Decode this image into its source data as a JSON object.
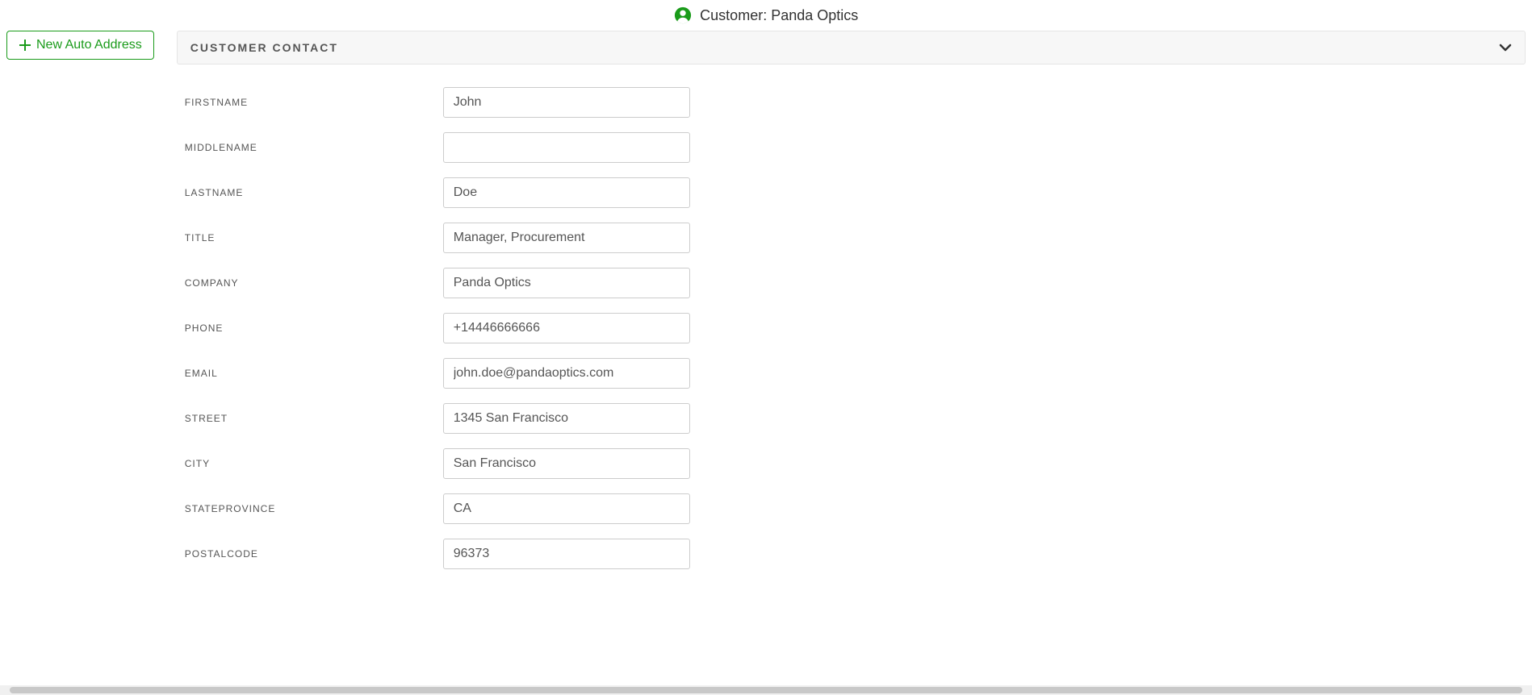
{
  "header": {
    "title": "Customer: Panda Optics"
  },
  "sidebar": {
    "new_address_label": "New Auto Address"
  },
  "panel": {
    "title": "CUSTOMER  CONTACT"
  },
  "form": {
    "firstname": {
      "label": "FIRSTNAME",
      "value": "John"
    },
    "middlename": {
      "label": "MIDDLENAME",
      "value": ""
    },
    "lastname": {
      "label": "LASTNAME",
      "value": "Doe"
    },
    "title": {
      "label": "TITLE",
      "value": "Manager, Procurement"
    },
    "company": {
      "label": "COMPANY",
      "value": "Panda Optics"
    },
    "phone": {
      "label": "PHONE",
      "value": "+14446666666"
    },
    "email": {
      "label": "EMAIL",
      "value": "john.doe@pandaoptics.com"
    },
    "street": {
      "label": "STREET",
      "value": "1345 San Francisco"
    },
    "city": {
      "label": "CITY",
      "value": "San Francisco"
    },
    "stateprovince": {
      "label": "STATEPROVINCE",
      "value": "CA"
    },
    "postalcode": {
      "label": "POSTALCODE",
      "value": "96373"
    }
  },
  "colors": {
    "accent_green": "#1a9b1a"
  }
}
